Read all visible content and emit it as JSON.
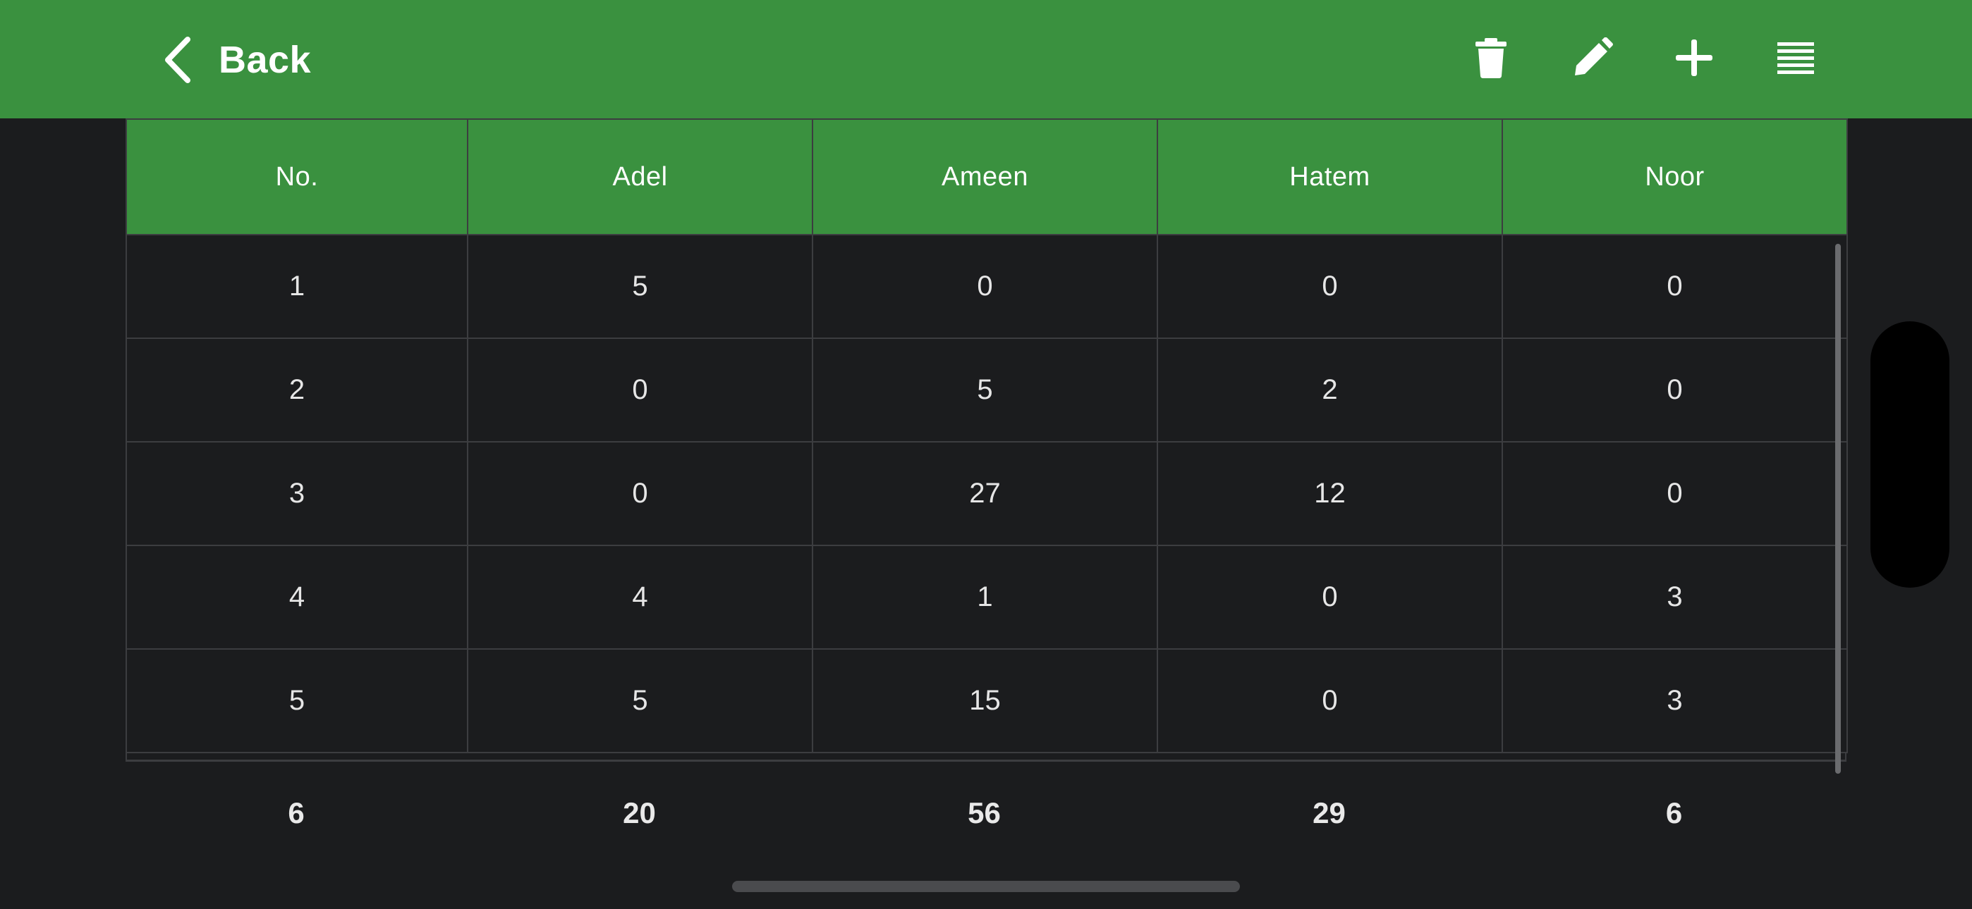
{
  "header": {
    "back_label": "Back",
    "back_icon": "chevron-left-icon",
    "actions": [
      {
        "name": "delete",
        "icon": "trash-icon"
      },
      {
        "name": "edit",
        "icon": "pencil-icon"
      },
      {
        "name": "add",
        "icon": "plus-icon"
      },
      {
        "name": "menu",
        "icon": "lines-menu-icon"
      }
    ]
  },
  "table": {
    "columns": [
      "No.",
      "Adel",
      "Ameen",
      "Hatem",
      "Noor"
    ],
    "rows": [
      [
        "1",
        "5",
        "0",
        "0",
        "0"
      ],
      [
        "2",
        "0",
        "5",
        "2",
        "0"
      ],
      [
        "3",
        "0",
        "27",
        "12",
        "0"
      ],
      [
        "4",
        "4",
        "1",
        "0",
        "3"
      ],
      [
        "5",
        "5",
        "15",
        "0",
        "3"
      ]
    ],
    "totals": [
      "6",
      "20",
      "56",
      "29",
      "6"
    ]
  },
  "colors": {
    "header_green": "#3a913f",
    "background": "#1b1c1e",
    "grid_line": "#3c3d40"
  }
}
